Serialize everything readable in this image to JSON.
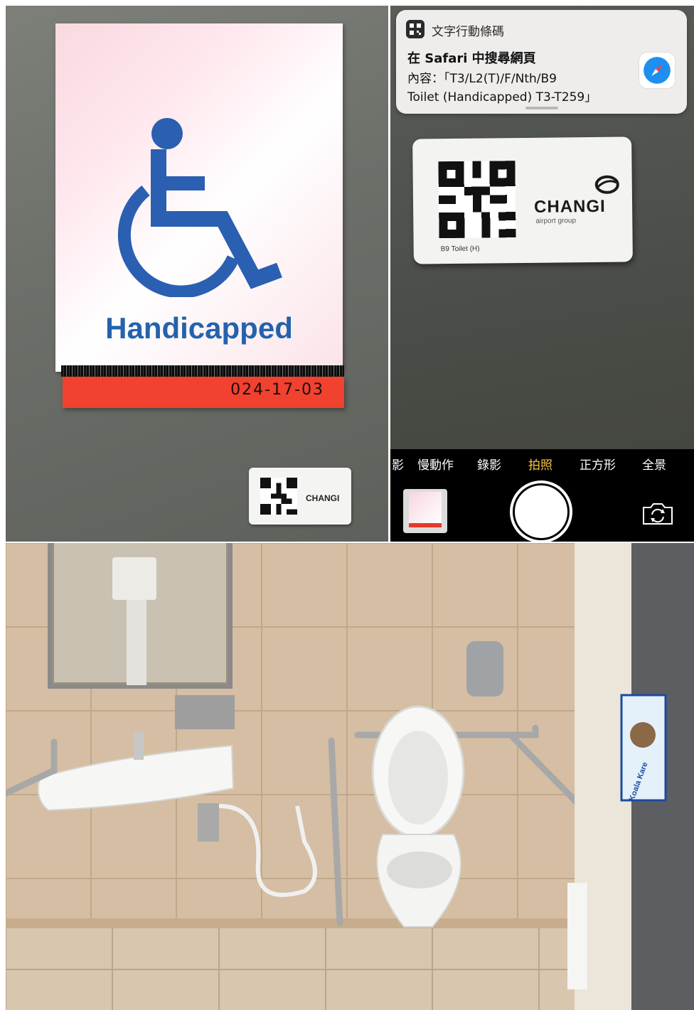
{
  "sign": {
    "label": "Handicapped",
    "code": "024-17-03"
  },
  "small_label": {
    "brand": "CHANGI"
  },
  "notification": {
    "app_name": "文字行動條碼",
    "title": "在 Safari 中搜尋網頁",
    "line1": "內容：「T3/L2(T)/F/Nth/B9",
    "line2": "Toilet (Handicapped) T3-T259」"
  },
  "qr_label": {
    "brand": "CHANGI",
    "brand_sub": "airport group",
    "caption": "B9 Toilet (H)"
  },
  "camera": {
    "modes": [
      "影",
      "慢動作",
      "錄影",
      "拍照",
      "正方形",
      "全景"
    ],
    "active_mode": "拍照"
  },
  "toilet_scene": {
    "poster_text": "Koala Kare"
  },
  "colors": {
    "sign_blue": "#2462ad",
    "sign_red": "#f0422f",
    "active_mode": "#f6c544"
  }
}
